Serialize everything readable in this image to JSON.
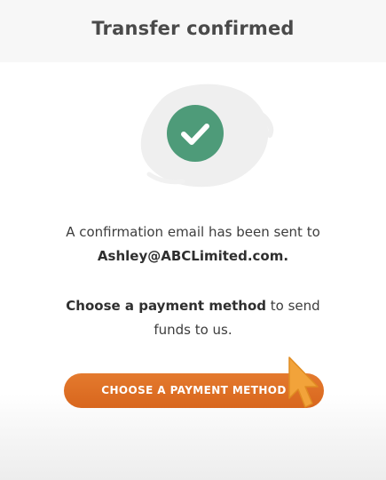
{
  "header": {
    "title": "Transfer confirmed"
  },
  "confirmation": {
    "line1": "A confirmation email has been sent to",
    "email": "Ashley@ABCLimited.com."
  },
  "payment": {
    "bold": "Choose a payment method",
    "rest_inline": " to send",
    "rest_line2": "funds to us."
  },
  "cta": {
    "label": "CHOOSE A PAYMENT METHOD"
  },
  "icons": {
    "success": "check-circle-icon",
    "pointer": "mouse-cursor-icon"
  },
  "colors": {
    "success_green": "#4e9b79",
    "cta_orange": "#e0722a",
    "cursor_orange": "#f2a33a"
  }
}
